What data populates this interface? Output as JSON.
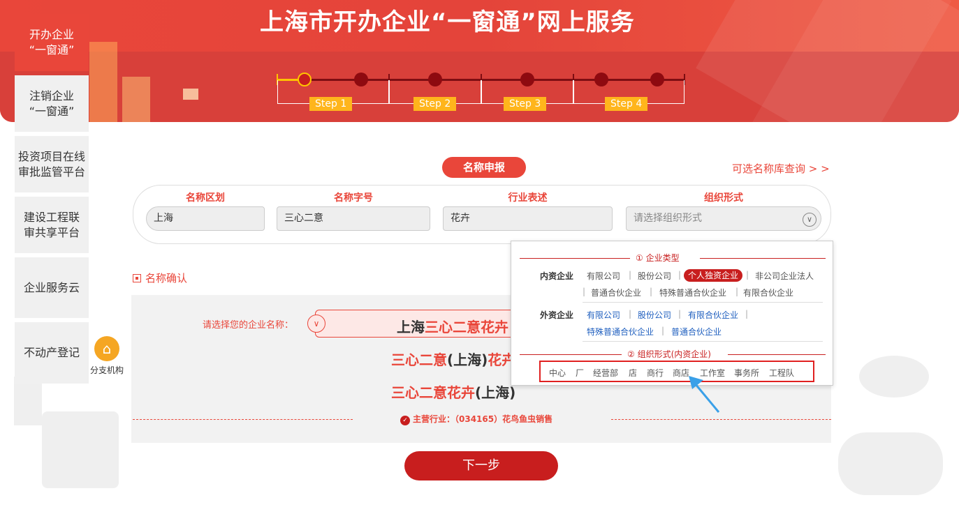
{
  "banner": {
    "title": "上海市开办企业“一窗通”网上服务",
    "steps": [
      "Step 1",
      "Step 2",
      "Step 3",
      "Step 4"
    ]
  },
  "sidebar": {
    "items": [
      {
        "label": "开办企业 “一窗通”",
        "active": true
      },
      {
        "label": "注销企业 “一窗通”",
        "active": false
      },
      {
        "label": "投资项目在线 审批监管平台",
        "active": false
      },
      {
        "label": "建设工程联 审共享平台",
        "active": false
      },
      {
        "label": "企业服务云",
        "active": false
      },
      {
        "label": "不动产登记",
        "active": false
      }
    ],
    "branch_label": "分支机构",
    "branch_icon": "home-icon"
  },
  "main": {
    "section_pill": "名称申报",
    "alt_link": "可选名称库查询 > >",
    "fields": {
      "region": {
        "label": "名称区划",
        "value": "上海"
      },
      "brand": {
        "label": "名称字号",
        "value": "三心二意"
      },
      "industry": {
        "label": "行业表述",
        "value": "花卉"
      },
      "org_form": {
        "label": "组织形式",
        "placeholder": "请选择组织形式"
      }
    },
    "confirm_title": "名称确认",
    "choose_label": "请选择您的企业名称：",
    "options": [
      {
        "part1": "上海",
        "part2": "三心二意花卉"
      },
      {
        "part1": "三心二意",
        "part2": "(上海)",
        "part3": "花卉"
      },
      {
        "part1": "三心二意花卉",
        "part2": "(上海)"
      }
    ],
    "main_industry": "主营行业：（034165）花鸟鱼虫销售",
    "next_button": "下一步"
  },
  "popup": {
    "sec1_title": "① 企业类型",
    "domestic_label": "内资企业",
    "domestic_types": [
      "有限公司",
      "股份公司",
      "个人独资企业",
      "非公司企业法人",
      "普通合伙企业",
      "特殊普通合伙企业",
      "有限合伙企业"
    ],
    "selected_type": "个人独资企业",
    "foreign_label": "外资企业",
    "foreign_types": [
      "有限公司",
      "股份公司",
      "有限合伙企业",
      "特殊普通合伙企业",
      "普通合伙企业"
    ],
    "sec2_title": "② 组织形式(内资企业)",
    "org_forms": [
      "中心",
      "厂",
      "经营部",
      "店",
      "商行",
      "商店",
      "工作室",
      "事务所",
      "工程队"
    ]
  },
  "colors": {
    "brand_red": "#e9463a",
    "dark_red": "#c81e1e",
    "step_label": "#ffb51c",
    "foreign_link": "#1f5fbf",
    "annotation_arrow": "#3aa0e8"
  }
}
